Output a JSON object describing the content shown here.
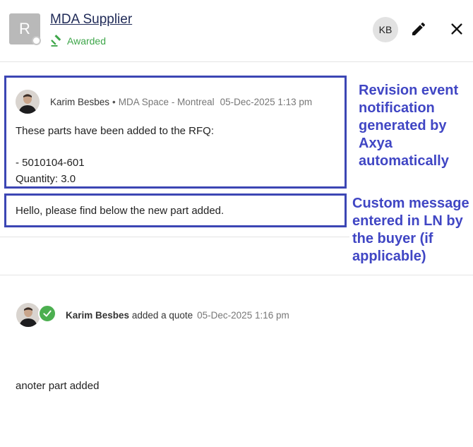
{
  "header": {
    "avatar_letter": "R",
    "supplier_name": "MDA Supplier",
    "status": "Awarded",
    "user_initials": "KB"
  },
  "event": {
    "author": "Karim Besbes",
    "organization": "MDA Space - Montreal",
    "timestamp": "05-Dec-2025 1:13 pm",
    "line1": "These parts have been added to the RFQ:",
    "line2": "- 5010104-601",
    "line3": "Quantity: 3.0"
  },
  "custom_message": "Hello, please find below the new part added.",
  "annotations": {
    "revision": [
      "Revision event",
      "notification",
      "generated by",
      "Axya",
      "automatically"
    ],
    "custom": [
      "Custom message",
      "entered in LN by",
      "the buyer (if",
      "applicable)"
    ]
  },
  "quote": {
    "author": "Karim Besbes",
    "action": "added a quote",
    "timestamp": "05-Dec-2025 1:16 pm",
    "message": "anoter part added"
  },
  "colors": {
    "annotation": "#4046c4",
    "awarded": "#3ea64a",
    "check": "#4caf50"
  },
  "icons": [
    "gavel-icon",
    "pencil-icon",
    "close-icon",
    "check-icon"
  ]
}
